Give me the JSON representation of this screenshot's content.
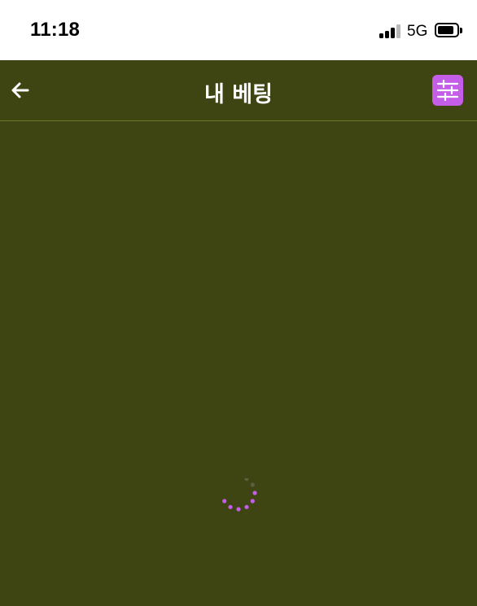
{
  "status_bar": {
    "time": "11:18",
    "network": "5G",
    "signal_bars_lit": 3,
    "signal_bars_total": 4,
    "battery_level": 0.85
  },
  "header": {
    "title": "내 베팅",
    "back_icon": "arrow-left-icon",
    "filter_icon": "sliders-icon"
  },
  "content": {
    "state": "loading",
    "spinner_icon": "loading-spinner-icon"
  },
  "colors": {
    "background": "#3e4512",
    "header_divider": "#6c7a2b",
    "accent": "#c45ee8",
    "status_bar_bg": "#ffffff",
    "signal_dim": "#b8b8b8"
  }
}
